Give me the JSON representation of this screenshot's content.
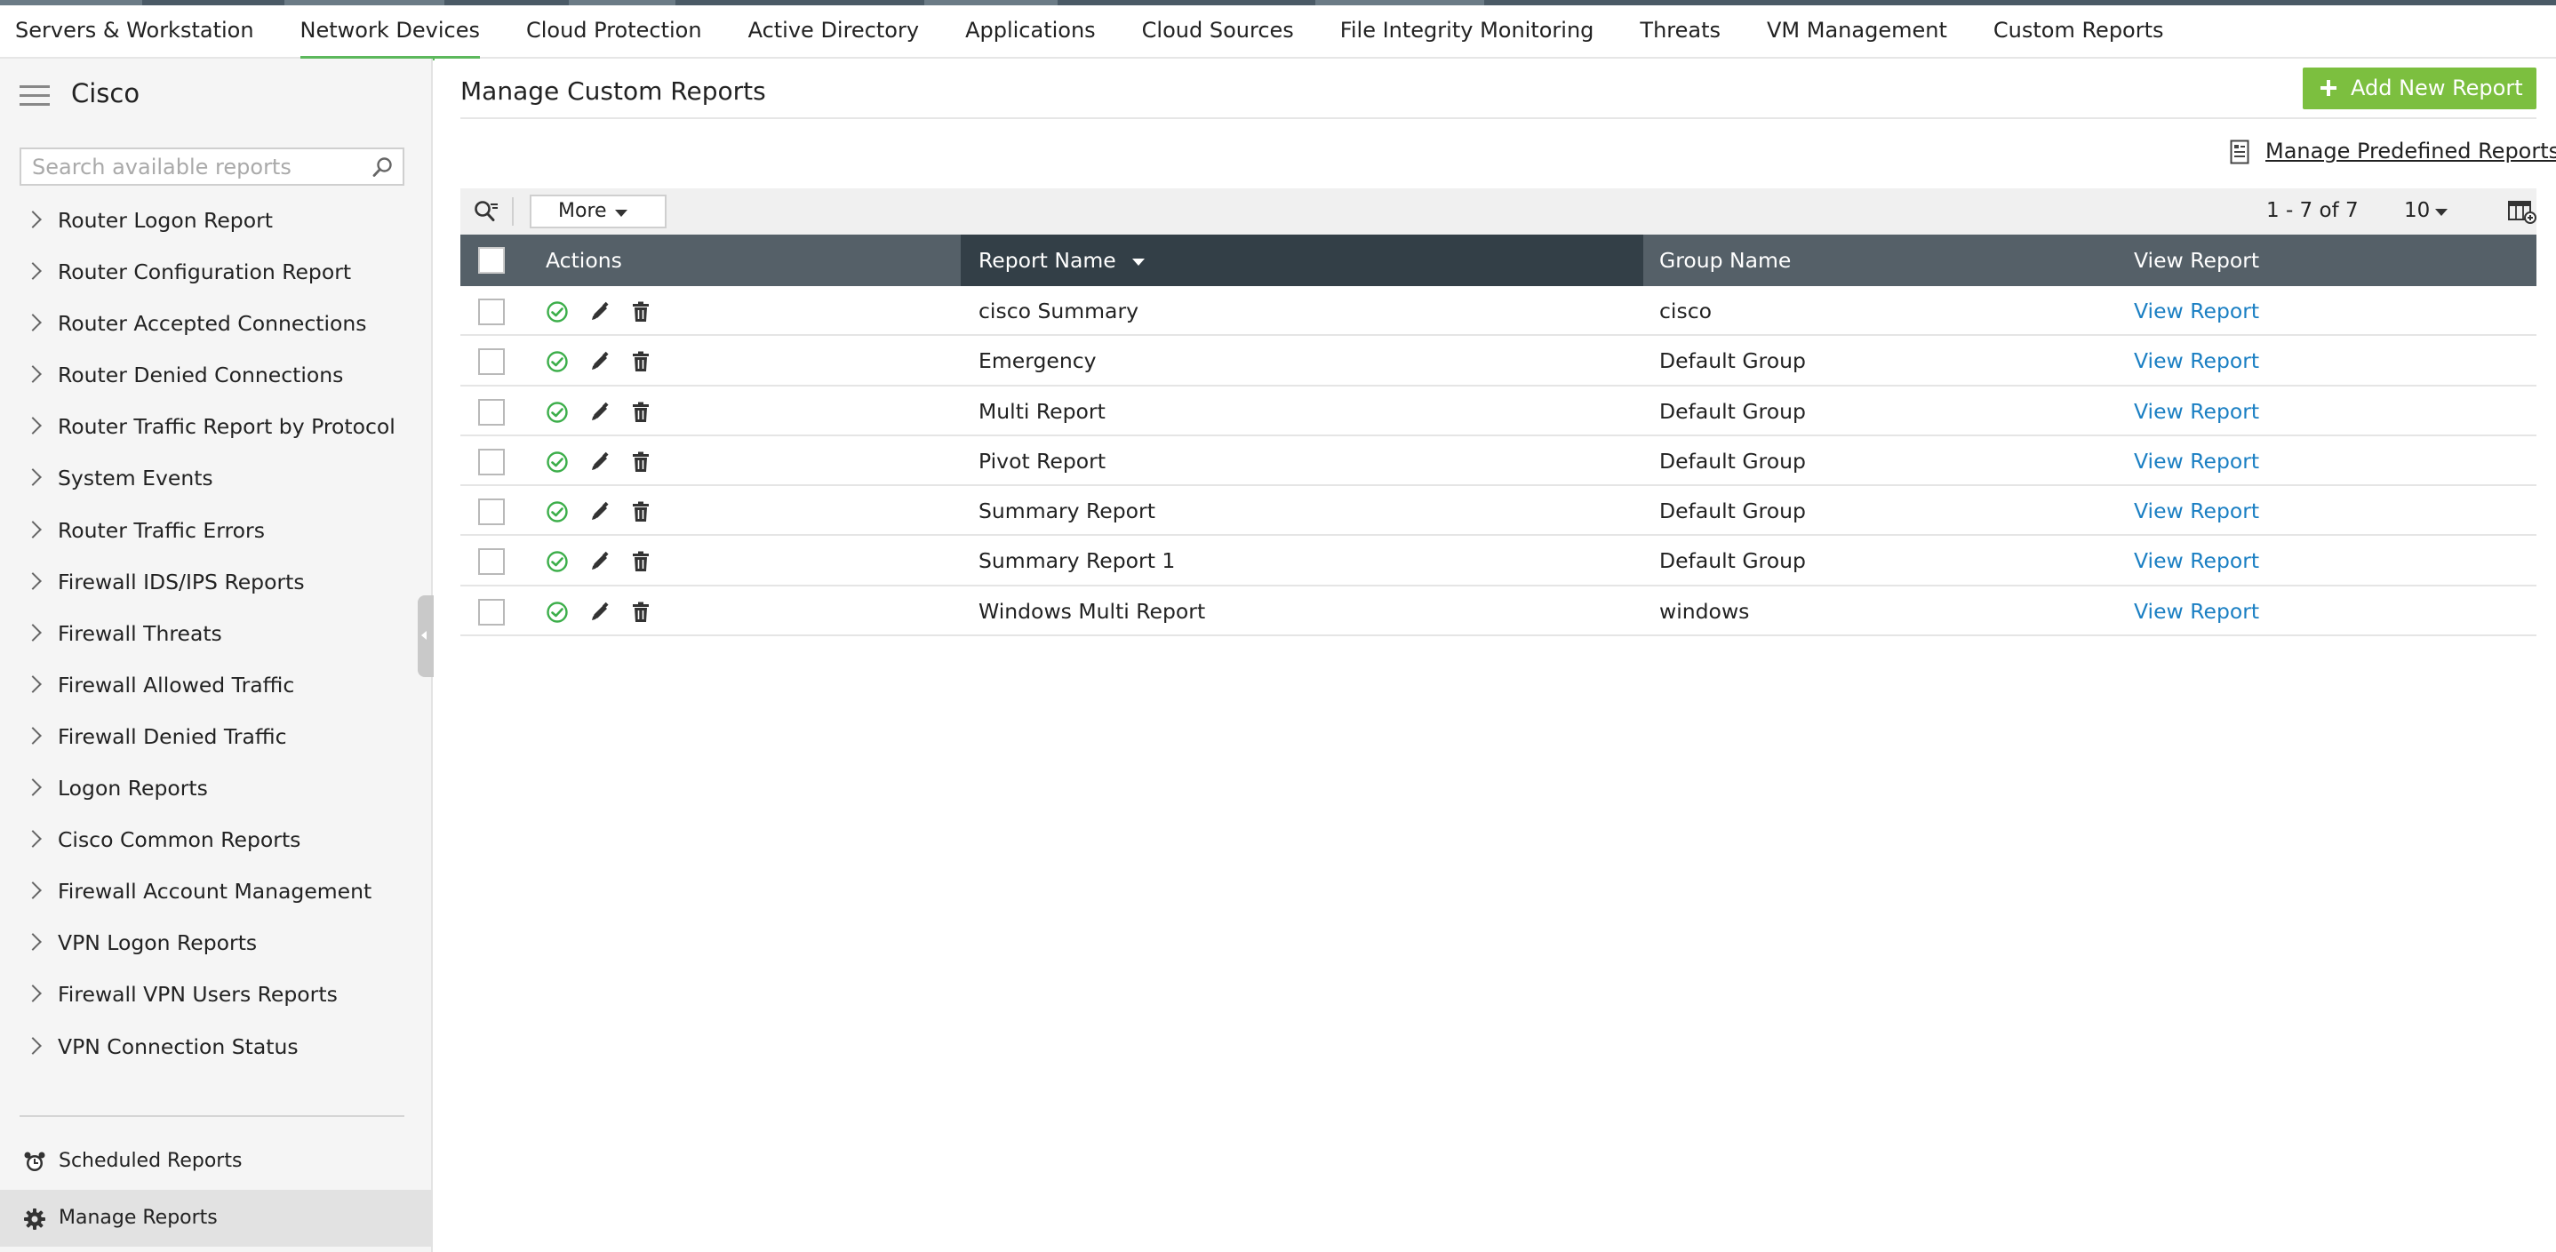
{
  "nav": {
    "tabs": [
      {
        "label": "Servers & Workstation",
        "active": false
      },
      {
        "label": "Network Devices",
        "active": true
      },
      {
        "label": "Cloud Protection",
        "active": false
      },
      {
        "label": "Active Directory",
        "active": false
      },
      {
        "label": "Applications",
        "active": false
      },
      {
        "label": "Cloud Sources",
        "active": false
      },
      {
        "label": "File Integrity Monitoring",
        "active": false
      },
      {
        "label": "Threats",
        "active": false
      },
      {
        "label": "VM Management",
        "active": false
      },
      {
        "label": "Custom Reports",
        "active": false
      }
    ]
  },
  "sidebar": {
    "title": "Cisco",
    "search_placeholder": "Search available reports",
    "items": [
      "Router Logon Report",
      "Router Configuration Report",
      "Router Accepted Connections",
      "Router Denied Connections",
      "Router Traffic Report by Protocol",
      "System Events",
      "Router Traffic Errors",
      "Firewall IDS/IPS Reports",
      "Firewall Threats",
      "Firewall Allowed Traffic",
      "Firewall Denied Traffic",
      "Logon Reports",
      "Cisco Common Reports",
      "Firewall Account Management",
      "VPN Logon Reports",
      "Firewall VPN Users Reports",
      "VPN Connection Status"
    ],
    "scheduled_label": "Scheduled Reports",
    "manage_label": "Manage Reports"
  },
  "main": {
    "title": "Manage Custom Reports",
    "add_button": "Add New Report",
    "predefined_link": "Manage Predefined Reports",
    "toolbar": {
      "more_label": "More",
      "pager": "1 - 7 of 7",
      "per_page": "10"
    },
    "table": {
      "columns": {
        "actions": "Actions",
        "report_name": "Report Name",
        "group_name": "Group Name",
        "view_report": "View Report"
      },
      "rows": [
        {
          "name": "cisco Summary",
          "group": "cisco",
          "link": "View Report"
        },
        {
          "name": "Emergency",
          "group": "Default Group",
          "link": "View Report"
        },
        {
          "name": "Multi Report",
          "group": "Default Group",
          "link": "View Report"
        },
        {
          "name": "Pivot Report",
          "group": "Default Group",
          "link": "View Report"
        },
        {
          "name": "Summary Report",
          "group": "Default Group",
          "link": "View Report"
        },
        {
          "name": "Summary Report 1",
          "group": "Default Group",
          "link": "View Report"
        },
        {
          "name": "Windows Multi Report",
          "group": "windows",
          "link": "View Report"
        }
      ]
    }
  },
  "colors": {
    "accent_green": "#7cbf3f",
    "nav_active": "#5cb85c",
    "table_header": "#556068",
    "table_header_sorted": "#333f47",
    "link_blue": "#1a7fc3",
    "enabled_green": "#3cae4a"
  }
}
